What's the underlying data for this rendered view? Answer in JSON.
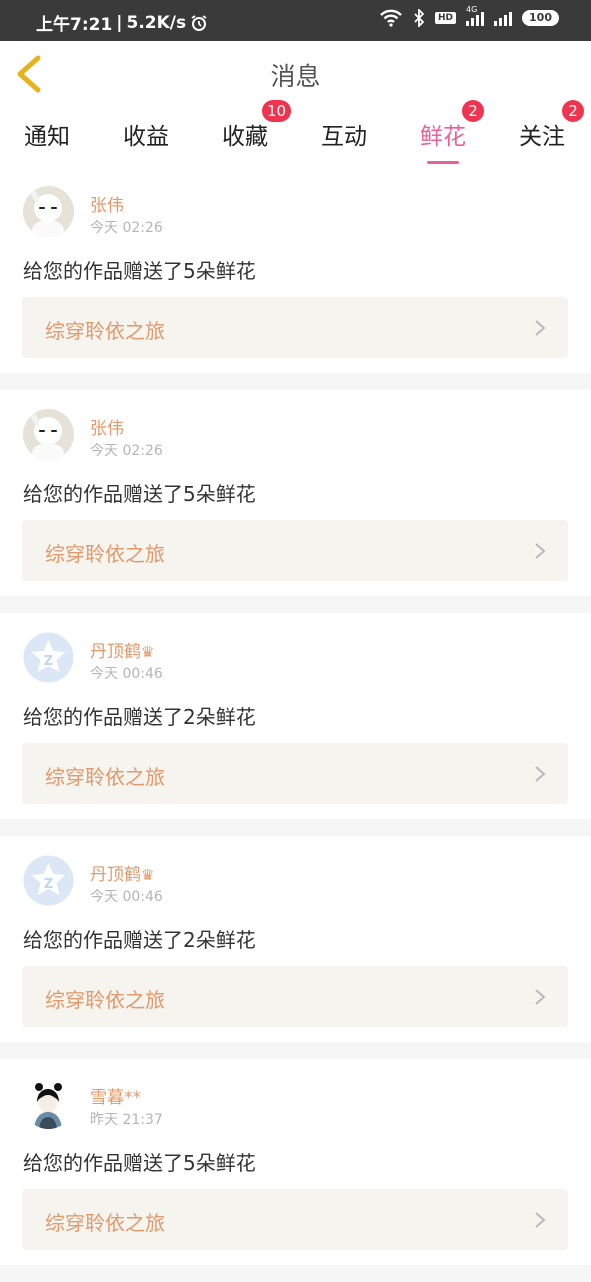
{
  "status_bar": {
    "time": "上午7:21",
    "separator": "|",
    "speed": "5.2K/s",
    "network_tag": "4G",
    "hd": "HD",
    "battery": "100"
  },
  "header": {
    "title": "消息"
  },
  "tabs": [
    {
      "label": "通知",
      "badge": ""
    },
    {
      "label": "收益",
      "badge": ""
    },
    {
      "label": "收藏",
      "badge": "10"
    },
    {
      "label": "互动",
      "badge": ""
    },
    {
      "label": "鲜花",
      "badge": "2",
      "active": true
    },
    {
      "label": "关注",
      "badge": "2"
    }
  ],
  "messages": [
    {
      "user": "张伟",
      "crown": "",
      "time": "今天 02:26",
      "text": "给您的作品赠送了5朵鲜花",
      "work": "综穿聆依之旅",
      "avatar": "white-doll-avatar"
    },
    {
      "user": "张伟",
      "crown": "",
      "time": "今天 02:26",
      "text": "给您的作品赠送了5朵鲜花",
      "work": "综穿聆依之旅",
      "avatar": "white-doll-avatar"
    },
    {
      "user": "丹顶鹤",
      "crown": "♛",
      "time": "今天 00:46",
      "text": "给您的作品赠送了2朵鲜花",
      "work": "综穿聆依之旅",
      "avatar": "default-star-avatar"
    },
    {
      "user": "丹顶鹤",
      "crown": "♛",
      "time": "今天 00:46",
      "text": "给您的作品赠送了2朵鲜花",
      "work": "综穿聆依之旅",
      "avatar": "default-star-avatar"
    },
    {
      "user": "雪暮**",
      "crown": "",
      "time": "昨天 21:37",
      "text": "给您的作品赠送了5朵鲜花",
      "work": "综穿聆依之旅",
      "avatar": "cartoon-person-avatar"
    }
  ],
  "colors": {
    "accent": "#e9609a",
    "badge": "#f0344f",
    "name": "#e3996a",
    "back_arrow": "#e8b21a"
  }
}
